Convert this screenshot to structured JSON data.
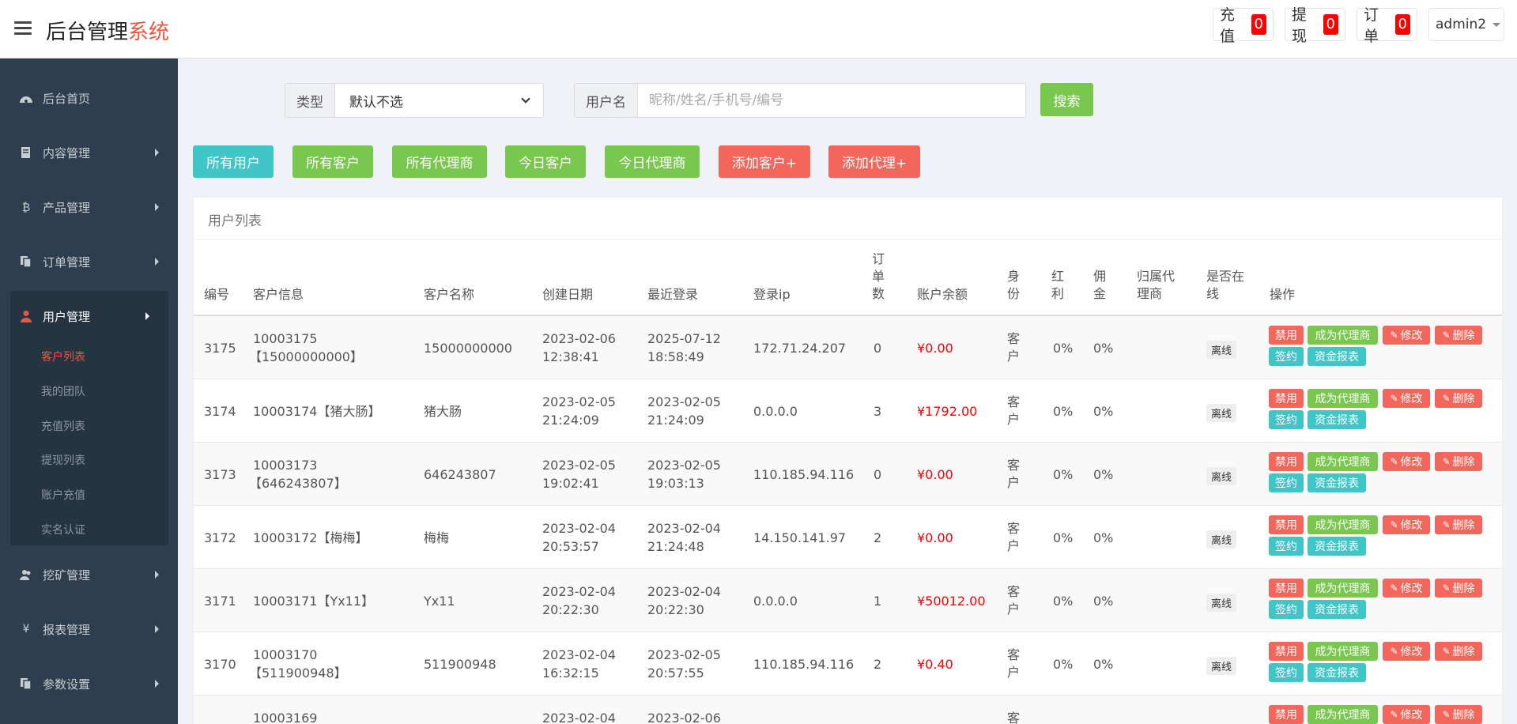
{
  "header": {
    "brand_main": "后台管理",
    "brand_accent": "系统",
    "recharge_label": "充值",
    "recharge_count": "0",
    "withdraw_label": "提现",
    "withdraw_count": "0",
    "orders_label": "订单",
    "orders_count": "0",
    "user": "admin2"
  },
  "sidebar": {
    "items": [
      {
        "label": "后台首页",
        "icon": "dashboard-icon"
      },
      {
        "label": "内容管理",
        "icon": "document-icon"
      },
      {
        "label": "产品管理",
        "icon": "bitcoin-icon"
      },
      {
        "label": "订单管理",
        "icon": "copy-icon"
      },
      {
        "label": "用户管理",
        "icon": "user-icon"
      },
      {
        "label": "挖矿管理",
        "icon": "users-icon"
      },
      {
        "label": "报表管理",
        "icon": "yen-icon"
      },
      {
        "label": "参数设置",
        "icon": "copy-icon"
      }
    ],
    "subitems": [
      "客户列表",
      "我的团队",
      "充值列表",
      "提现列表",
      "账户充值",
      "实名认证"
    ]
  },
  "search": {
    "type_label": "类型",
    "type_value": "默认不选",
    "username_label": "用户名",
    "username_placeholder": "昵称/姓名/手机号/编号",
    "button": "搜索"
  },
  "filters": [
    "所有用户",
    "所有客户",
    "所有代理商",
    "今日客户",
    "今日代理商",
    "添加客户+",
    "添加代理+"
  ],
  "panel": {
    "title": "用户列表"
  },
  "table": {
    "headers": {
      "id": "编号",
      "info": "客户信息",
      "name": "客户名称",
      "created": "创建日期",
      "last_login": "最近登录",
      "ip": "登录ip",
      "orders": "订单数",
      "balance": "账户余额",
      "role": "身份",
      "bonus": "红利",
      "commission": "佣金",
      "agent": "归属代理商",
      "online": "是否在线",
      "actions": "操作"
    },
    "rows": [
      {
        "id": "3175",
        "info1": "10003175",
        "info2": "【15000000000】",
        "name": "15000000000",
        "c1": "2023-02-06",
        "c2": "12:38:41",
        "l1": "2025-07-12",
        "l2": "18:58:49",
        "ip": "172.71.24.207",
        "orders": "0",
        "balance": "¥0.00",
        "role": "客户",
        "bonus": "0%",
        "commission": "0%",
        "online": "离线"
      },
      {
        "id": "3174",
        "info1": "10003174【猪大肠】",
        "info2": "",
        "name": "猪大肠",
        "c1": "2023-02-05",
        "c2": "21:24:09",
        "l1": "2023-02-05",
        "l2": "21:24:09",
        "ip": "0.0.0.0",
        "orders": "3",
        "balance": "¥1792.00",
        "role": "客户",
        "bonus": "0%",
        "commission": "0%",
        "online": "离线"
      },
      {
        "id": "3173",
        "info1": "10003173",
        "info2": "【646243807】",
        "name": "646243807",
        "c1": "2023-02-05",
        "c2": "19:02:41",
        "l1": "2023-02-05",
        "l2": "19:03:13",
        "ip": "110.185.94.116",
        "orders": "0",
        "balance": "¥0.00",
        "role": "客户",
        "bonus": "0%",
        "commission": "0%",
        "online": "离线"
      },
      {
        "id": "3172",
        "info1": "10003172【梅梅】",
        "info2": "",
        "name": "梅梅",
        "c1": "2023-02-04",
        "c2": "20:53:57",
        "l1": "2023-02-04",
        "l2": "21:24:48",
        "ip": "14.150.141.97",
        "orders": "2",
        "balance": "¥0.00",
        "role": "客户",
        "bonus": "0%",
        "commission": "0%",
        "online": "离线"
      },
      {
        "id": "3171",
        "info1": "10003171【Yx11】",
        "info2": "",
        "name": "Yx11",
        "c1": "2023-02-04",
        "c2": "20:22:30",
        "l1": "2023-02-04",
        "l2": "20:22:30",
        "ip": "0.0.0.0",
        "orders": "1",
        "balance": "¥50012.00",
        "role": "客户",
        "bonus": "0%",
        "commission": "0%",
        "online": "离线"
      },
      {
        "id": "3170",
        "info1": "10003170",
        "info2": "【511900948】",
        "name": "511900948",
        "c1": "2023-02-04",
        "c2": "16:32:15",
        "l1": "2023-02-05",
        "l2": "20:57:55",
        "ip": "110.185.94.116",
        "orders": "2",
        "balance": "¥0.40",
        "role": "客户",
        "bonus": "0%",
        "commission": "0%",
        "online": "离线"
      },
      {
        "id": "",
        "info1": "10003169",
        "info2": "",
        "name": "",
        "c1": "2023-02-04",
        "c2": "",
        "l1": "2023-02-06",
        "l2": "",
        "ip": "",
        "orders": "",
        "balance": "",
        "role": "客",
        "bonus": "",
        "commission": "",
        "online": ""
      }
    ],
    "actions": {
      "disable": "禁用",
      "make_agent": "成为代理商",
      "edit": "修改",
      "delete": "删除",
      "sign": "签约",
      "fund_report": "资金报表"
    }
  },
  "colors": {
    "sidebar": "#2e3e4e",
    "accent_red": "#e9573f",
    "teal": "#41c6c8",
    "green": "#7ac74f",
    "red": "#f2665c"
  }
}
